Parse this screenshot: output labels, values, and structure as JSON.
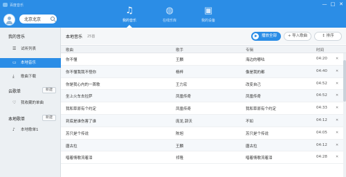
{
  "app": {
    "title": "百度音乐"
  },
  "window_controls": [
    "—",
    "□",
    "✕"
  ],
  "header": {
    "city": "北京北京",
    "nav": [
      {
        "label": "我的音乐",
        "icon": "music-note-icon",
        "glyph": "♫"
      },
      {
        "label": "在线乐库",
        "icon": "globe-icon",
        "glyph": "◍"
      },
      {
        "label": "我的设备",
        "icon": "devices-icon",
        "glyph": "▣"
      }
    ]
  },
  "sidebar": {
    "my_music": "我的音乐",
    "items": [
      {
        "label": "试听列表",
        "icon": "list-icon",
        "glyph": "☰"
      },
      {
        "label": "本地音乐",
        "icon": "computer-icon",
        "glyph": "▭"
      },
      {
        "label": "歌曲下载",
        "icon": "download-icon",
        "glyph": "⤓"
      }
    ],
    "cloud_title": "云歌单",
    "cloud_btn": "新建",
    "cloud_items": [
      {
        "label": "我收藏的单曲",
        "icon": "heart-icon",
        "glyph": "♡"
      }
    ],
    "local_title": "本地歌单",
    "local_btn": "新建",
    "local_items": [
      {
        "label": "本地歌单1",
        "icon": "playlist-icon",
        "glyph": "♪"
      }
    ]
  },
  "main": {
    "title": "本地音乐",
    "count": "25首",
    "play_all": "播放全部",
    "import": "+ 导入歌曲",
    "sort": "↕ 排序",
    "columns": {
      "title": "歌曲",
      "artist": "歌手",
      "album": "专辑",
      "time": "时间"
    },
    "rows": [
      {
        "title": "你不懂",
        "artist": "王麟",
        "album": "海边的嘟咕",
        "time": "04:20"
      },
      {
        "title": "你不懂我我不怪你",
        "artist": "杨梓",
        "album": "像是我的都",
        "time": "04:40"
      },
      {
        "title": "你是我心内的一首歌",
        "artist": "王力宏",
        "album": "改变自己",
        "time": "04:52"
      },
      {
        "title": "坐上火车去拉萨",
        "artist": "凤凰传奇",
        "album": "凤凰传奇",
        "time": "04:52"
      },
      {
        "title": "我和草原有个约定",
        "artist": "凤凰传奇",
        "album": "我和草原有个约定",
        "time": "04:33"
      },
      {
        "title": "到底是谁伤害了谁",
        "artist": "庞龙,郭沃",
        "album": "不如",
        "time": "04:12"
      },
      {
        "title": "苏只是个传说",
        "artist": "陈旭",
        "album": "苏只是个传说",
        "time": "04:05"
      },
      {
        "title": "唐古拉",
        "artist": "王麟",
        "album": "唐古拉",
        "time": "04:12"
      },
      {
        "title": "唱着情歌流着泪",
        "artist": "祁隆",
        "album": "唱着情歌流着泪",
        "time": "04:28"
      }
    ]
  }
}
